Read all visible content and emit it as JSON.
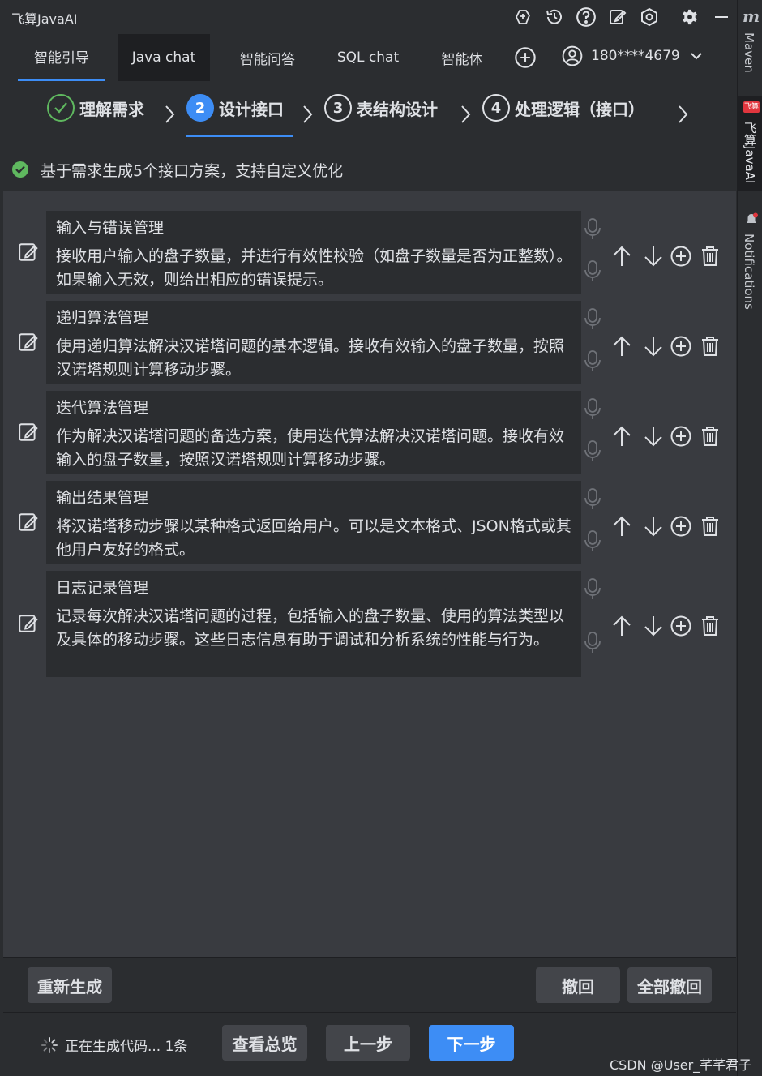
{
  "app": {
    "title": "飞算JavaAI"
  },
  "tabs": [
    {
      "label": "智能引导"
    },
    {
      "label": "Java chat"
    },
    {
      "label": "智能问答"
    },
    {
      "label": "SQL chat"
    },
    {
      "label": "智能体"
    }
  ],
  "user": {
    "account": "180****4679"
  },
  "steps": [
    {
      "num": "",
      "label": "理解需求",
      "state": "done"
    },
    {
      "num": "2",
      "label": "设计接口",
      "state": "current"
    },
    {
      "num": "3",
      "label": "表结构设计",
      "state": "todo"
    },
    {
      "num": "4",
      "label": "处理逻辑（接口）",
      "state": "todo"
    }
  ],
  "status": {
    "text": "基于需求生成5个接口方案，支持自定义优化"
  },
  "items": [
    {
      "title": "输入与错误管理",
      "desc": "接收用户输入的盘子数量，并进行有效性校验（如盘子数量是否为正整数）。如果输入无效，则给出相应的错误提示。"
    },
    {
      "title": "递归算法管理",
      "desc": "使用递归算法解决汉诺塔问题的基本逻辑。接收有效输入的盘子数量，按照汉诺塔规则计算移动步骤。"
    },
    {
      "title": "迭代算法管理",
      "desc": "作为解决汉诺塔问题的备选方案，使用迭代算法解决汉诺塔问题。接收有效输入的盘子数量，按照汉诺塔规则计算移动步骤。"
    },
    {
      "title": "输出结果管理",
      "desc": "将汉诺塔移动步骤以某种格式返回给用户。可以是文本格式、JSON格式或其他用户友好的格式。"
    },
    {
      "title": "日志记录管理",
      "desc": "记录每次解决汉诺塔问题的过程，包括输入的盘子数量、使用的算法类型以及具体的移动步骤。这些日志信息有助于调试和分析系统的性能与行为。"
    }
  ],
  "buttons": {
    "regenerate": "重新生成",
    "undo": "撤回",
    "undo_all": "全部撤回",
    "overview": "查看总览",
    "prev": "上一步",
    "next": "下一步"
  },
  "generation": {
    "text": "正在生成代码... 1条"
  },
  "sidebar": {
    "maven": "Maven",
    "javaai": "飞算JavaAI",
    "badge": "飞算",
    "notifications": "Notifications",
    "logo": "m"
  },
  "watermark": "CSDN @User_芊芊君子",
  "colors": {
    "accent": "#3d8df5",
    "success": "#5fb85f",
    "background": "#2b2d30",
    "panel": "#393b40"
  }
}
